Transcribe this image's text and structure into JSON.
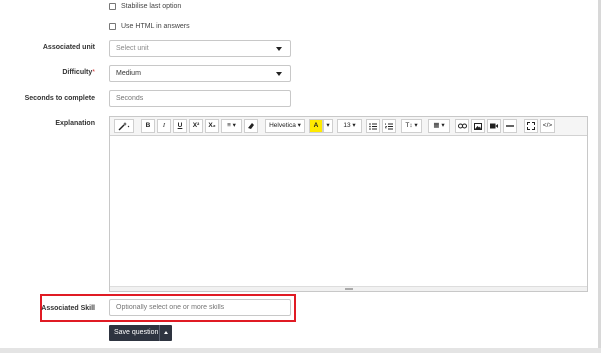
{
  "options": {
    "stabilise_label": "Stabilise last option",
    "html_answers_label": "Use HTML in answers"
  },
  "unit": {
    "label": "Associated unit",
    "selected": "Select unit"
  },
  "difficulty": {
    "label": "Difficulty",
    "required_mark": "*",
    "selected": "Medium"
  },
  "seconds": {
    "label": "Seconds to complete",
    "placeholder": "Seconds"
  },
  "explanation": {
    "label": "Explanation",
    "toolbar": {
      "style": "",
      "bold": "B",
      "italic": "I",
      "underline": "U",
      "superscript": "X²",
      "subscript": "X₂",
      "paragraph": "≡ ▾",
      "eraser": "",
      "font_name": "Helvetica ▾",
      "font_color": "A",
      "font_color_more": "▾",
      "font_size": "13 ▾",
      "ul": "☷",
      "ol": "☷",
      "text_size": "T↕ ▾",
      "table": "▦ ▾",
      "link": "🔗",
      "picture": "▣",
      "video": "■",
      "hr": "—",
      "fullscreen": "⤢",
      "code": "</>"
    }
  },
  "skill": {
    "label": "Associated Skill",
    "placeholder": "Optionally select one or more skills"
  },
  "save": {
    "label": "Save question"
  }
}
